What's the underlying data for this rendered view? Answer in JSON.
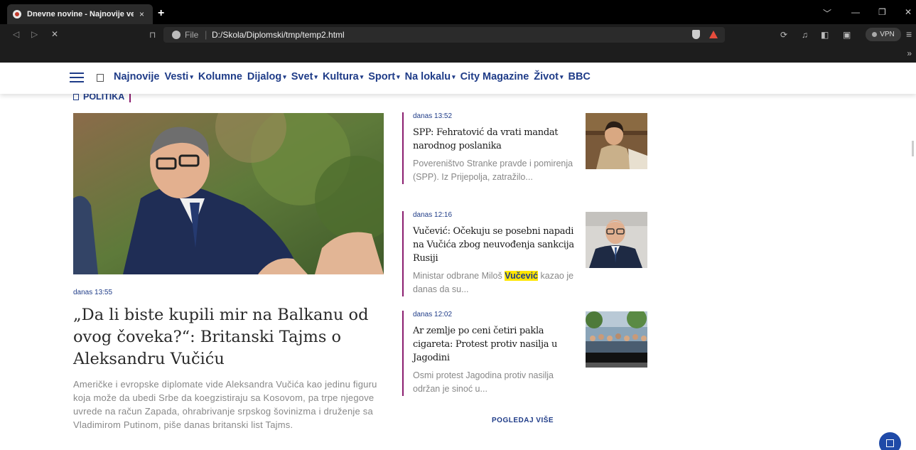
{
  "browser": {
    "tab_title": "Dnevne novine - Najnovije vesti -",
    "tab_close": "×",
    "new_tab": "+",
    "nav_back": "◁",
    "nav_forward": "▷",
    "nav_close": "✕",
    "url_label": "File",
    "url_separator": "|",
    "url": "D:/Skola/Diplomski/tmp/temp2.html",
    "vpn_label": "VPN",
    "more_bookmarks": "»",
    "window_controls": [
      "﹀",
      "—",
      "❐",
      "✕"
    ]
  },
  "site_nav": {
    "items": [
      {
        "label": "Najnovije",
        "caret": ""
      },
      {
        "label": "Vesti",
        "caret": "▾"
      },
      {
        "label": "Kolumne",
        "caret": ""
      },
      {
        "label": "Dijalog",
        "caret": "▾"
      },
      {
        "label": "Svet",
        "caret": "▾"
      },
      {
        "label": "Kultura",
        "caret": "▾"
      },
      {
        "label": "Sport",
        "caret": "▾"
      },
      {
        "label": "Na lokalu",
        "caret": "▾"
      },
      {
        "label": "City Magazine",
        "caret": ""
      },
      {
        "label": "Život",
        "caret": "▾"
      },
      {
        "label": "BBC",
        "caret": ""
      }
    ]
  },
  "section": {
    "label": "POLITIKA"
  },
  "main_article": {
    "time": "danas 13:55",
    "title": "„Da li biste kupili mir na Balkanu od ovog čoveka?“: Britanski Tajms o Aleksandru Vučiću",
    "excerpt": "Američke i evropske diplomate vide Aleksandra Vučića kao jedinu figuru koja može da ubedi Srbe da koegzistiraju sa Kosovom, pa trpe njegove uvrede na račun Zapada, ohrabrivanje srpskog šovinizma i druženje sa Vladimirom Putinom, piše danas britanski list Tajms."
  },
  "side_articles": [
    {
      "time": "danas 13:52",
      "title": "SPP: Fehratović da vrati mandat narodnog poslanika",
      "excerpt": "Povereništvo Stranke pravde i pomirenja (SPP). Iz Prijepolja, zatražilo..."
    },
    {
      "time": "danas 12:16",
      "title": "Vučević: Očekuju se posebni napadi na Vučića zbog neuvođenja sankcija Rusiji",
      "excerpt_before": "Ministar odbrane Miloš ",
      "excerpt_highlight": "Vučević",
      "excerpt_after": " kazao je danas da su..."
    },
    {
      "time": "danas 12:02",
      "title": "Ar zemlje po ceni četiri pakla cigareta: Protest protiv nasilja u Jagodini",
      "excerpt": "Osmi protest Jagodina protiv nasilja održan je sinoć u..."
    }
  ],
  "more_link": "POGLEDAJ VIŠE",
  "colors": {
    "brand_blue": "#1f3c88",
    "accent_purple": "#8b1e6f",
    "highlight": "#ffe600"
  }
}
